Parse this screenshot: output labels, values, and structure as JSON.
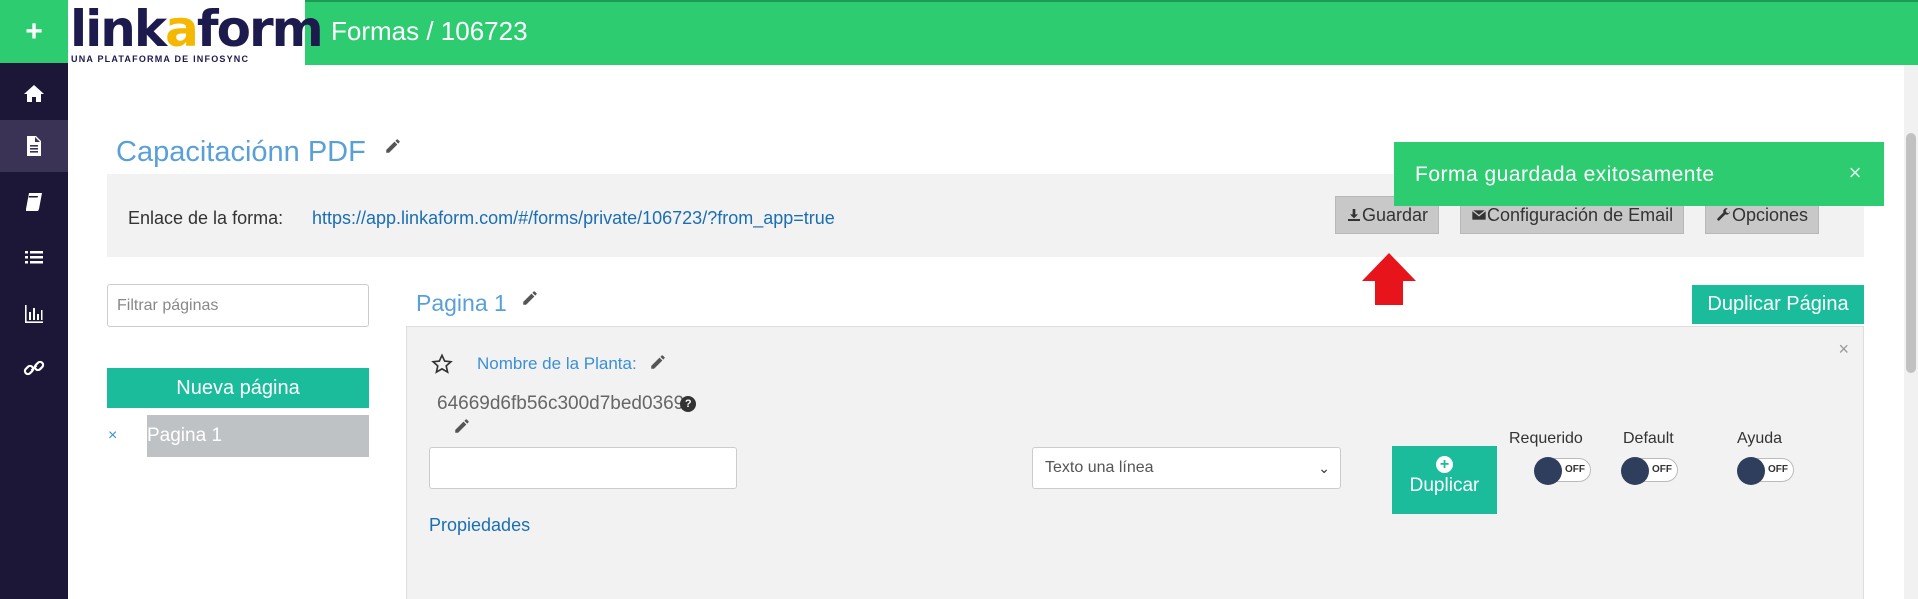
{
  "rail": {
    "add_label": "+",
    "items": [
      {
        "icon": "home-icon"
      },
      {
        "icon": "document-icon",
        "active": true
      },
      {
        "icon": "book-icon"
      },
      {
        "icon": "list-icon"
      },
      {
        "icon": "bar-chart-icon"
      },
      {
        "icon": "link-icon"
      }
    ]
  },
  "header": {
    "logo_text_a": "link",
    "logo_text_b": "a",
    "logo_text_c": "form",
    "logo_sub_a": "UNA PLATAFORMA DE ",
    "logo_sub_b": "INFOSYNC",
    "breadcrumb": "Formas / 106723"
  },
  "form": {
    "title": "Capacitaciónn PDF",
    "link_label": "Enlace de la forma:",
    "link_url": "https://app.linkaform.com/#/forms/private/106723/?from_app=true",
    "buttons": {
      "save": "Guardar",
      "email_config": "Configuración de Email",
      "options": "Opciones"
    }
  },
  "toast": {
    "message": "Forma guardada exitosamente",
    "close": "×"
  },
  "sidebar": {
    "filter_placeholder": "Filtrar páginas",
    "new_page_label": "Nueva página",
    "remove_symbol": "×",
    "pages": [
      "Pagina 1"
    ]
  },
  "page": {
    "title": "Pagina 1",
    "duplicate_page_label": "Duplicar Página",
    "card_close": "×",
    "field": {
      "label": "Nombre de la Planta:",
      "id": "64669d6fb56c300d7bed0369",
      "help": "?",
      "type_value": "Texto una línea",
      "duplicate_label": "Duplicar",
      "properties_label": "Propiedades",
      "toggles": [
        {
          "label": "Requerido",
          "state": "OFF"
        },
        {
          "label": "Default",
          "state": "OFF"
        },
        {
          "label": "Ayuda",
          "state": "OFF"
        }
      ]
    }
  },
  "colors": {
    "brand_green": "#2ecc71",
    "teal": "#1abc9c",
    "rail_bg": "#1c1637",
    "link_blue": "#1a6eb3",
    "title_blue": "#5aa0d8",
    "arrow_red": "#e8141c"
  }
}
